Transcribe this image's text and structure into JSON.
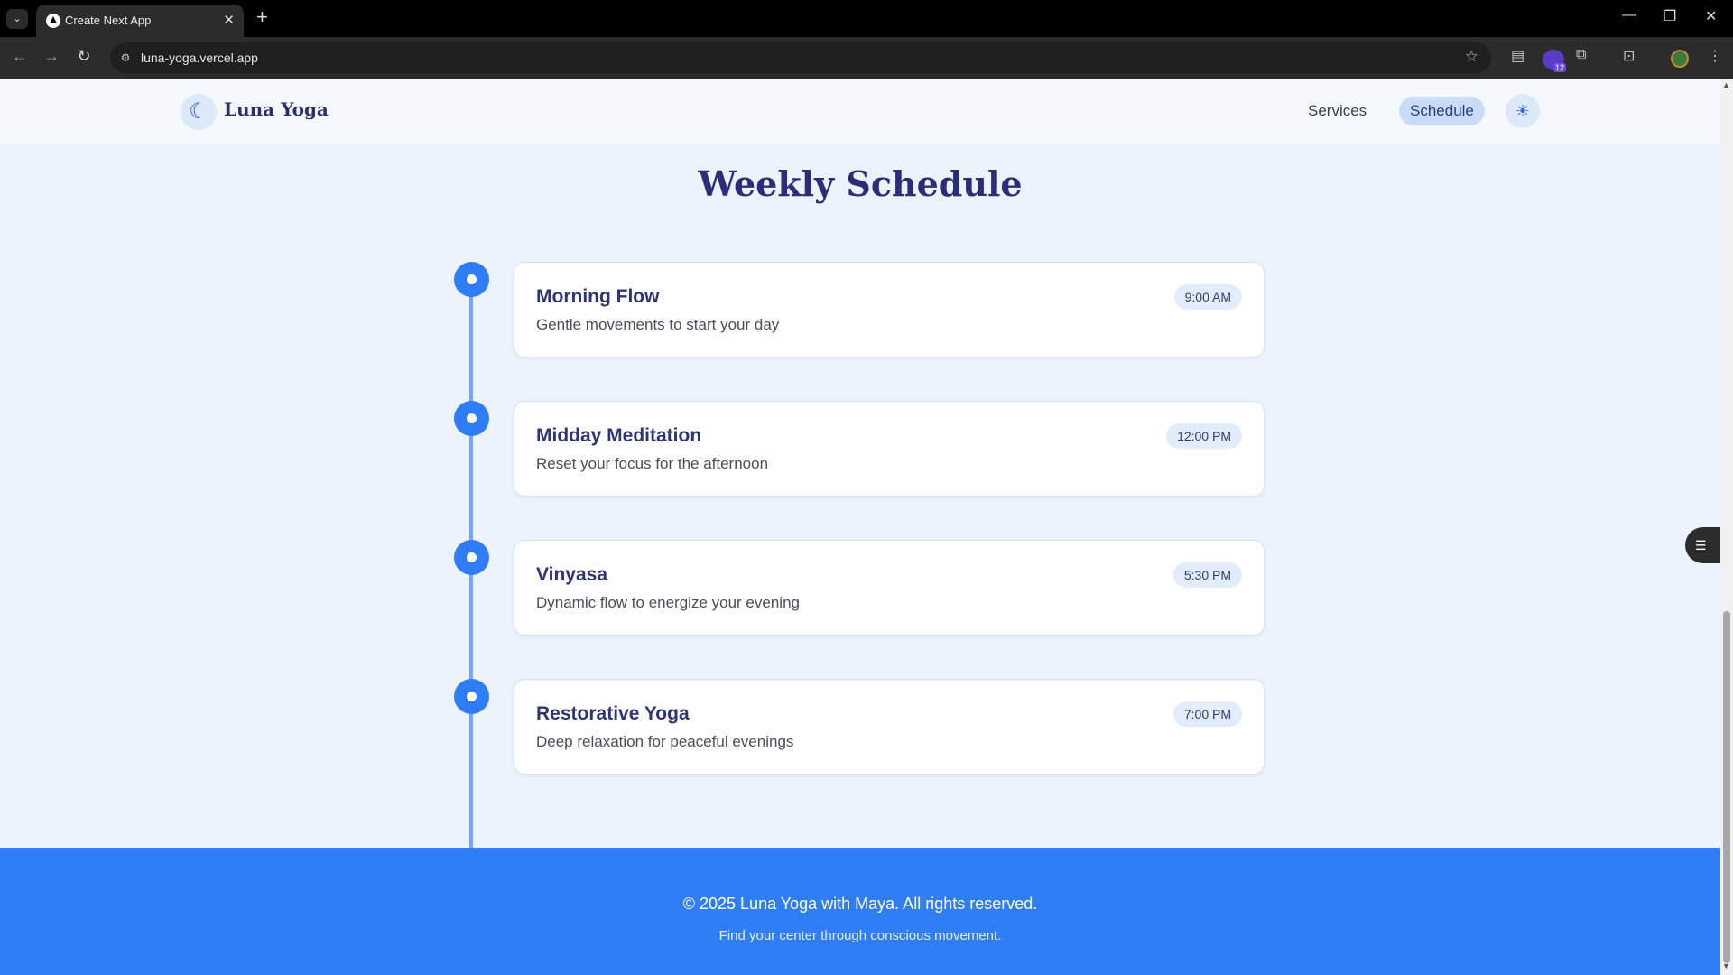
{
  "browser": {
    "tab_title": "Create Next App",
    "url": "luna-yoga.vercel.app",
    "extension_badge": "12"
  },
  "site": {
    "brand": "Luna Yoga",
    "nav": [
      {
        "label": "Services",
        "active": false
      },
      {
        "label": "Schedule",
        "active": true
      }
    ]
  },
  "schedule": {
    "title": "Weekly Schedule",
    "classes": [
      {
        "name": "Morning Flow",
        "description": "Gentle movements to start your day",
        "time": "9:00 AM"
      },
      {
        "name": "Midday Meditation",
        "description": "Reset your focus for the afternoon",
        "time": "12:00 PM"
      },
      {
        "name": "Vinyasa",
        "description": "Dynamic flow to energize your evening",
        "time": "5:30 PM"
      },
      {
        "name": "Restorative Yoga",
        "description": "Deep relaxation for peaceful evenings",
        "time": "7:00 PM"
      }
    ]
  },
  "footer": {
    "copyright": "© 2025 Luna Yoga with Maya. All rights reserved.",
    "tagline": "Find your center through conscious movement."
  },
  "colors": {
    "accent": "#2e7cf6",
    "heading": "#2b2d7a",
    "background": "#ecf3fd"
  },
  "icons": {
    "brand": "moon-icon",
    "theme_toggle": "sun-icon"
  }
}
